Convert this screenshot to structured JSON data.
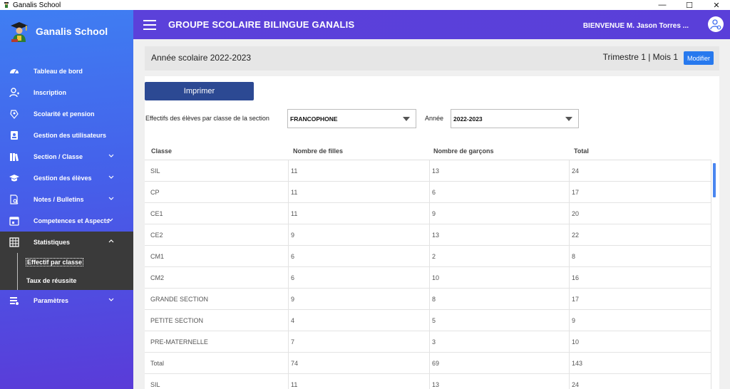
{
  "window": {
    "title": "Ganalis School",
    "controls": {
      "minimize": "—",
      "maximize": "☐",
      "close": "✕"
    }
  },
  "sidebar": {
    "brand": "Ganalis School",
    "items": [
      {
        "label": "Tableau de bord",
        "icon": "gauge-icon"
      },
      {
        "label": "Inscription",
        "icon": "add-user-icon"
      },
      {
        "label": "Scolarité et pension",
        "icon": "money-hand-icon"
      },
      {
        "label": "Gestion des utilisateurs",
        "icon": "id-badge-icon"
      },
      {
        "label": "Section / Classe",
        "icon": "books-icon"
      },
      {
        "label": "Gestion des élèves",
        "icon": "graduation-cap-icon"
      },
      {
        "label": "Notes / Bulletins",
        "icon": "document-search-icon"
      },
      {
        "label": "Competences et Aspects",
        "icon": "calendar-icon"
      },
      {
        "label": "Statistiques",
        "icon": "table-grid-icon"
      },
      {
        "label": "Paramètres",
        "icon": "settings-sliders-icon"
      }
    ],
    "statistics_sub": [
      "Effectif par classe",
      "Taux de réussite"
    ]
  },
  "header": {
    "org_name": "GROUPE SCOLAIRE BILINGUE GANALIS",
    "welcome": "BIENVENUE M.  Jason Torres ..."
  },
  "yearbar": {
    "label": "Année scolaire 2022-2023",
    "period": "Trimestre 1 | Mois  1",
    "modify": "Modifier"
  },
  "panel": {
    "print": "Imprimer",
    "filter_label": "Effectifs des élèves par classe de la section",
    "section_value": "FRANCOPHONE",
    "year_label": "Année",
    "year_value": "2022-2023"
  },
  "table": {
    "headers": [
      "Classe",
      "Nombre de filles",
      "Nombre de garçons",
      "Total"
    ],
    "rows": [
      [
        "SIL",
        "11",
        "13",
        "24"
      ],
      [
        "CP",
        "11",
        "6",
        "17"
      ],
      [
        "CE1",
        "11",
        "9",
        "20"
      ],
      [
        "CE2",
        "9",
        "13",
        "22"
      ],
      [
        "CM1",
        "6",
        "2",
        "8"
      ],
      [
        "CM2",
        "6",
        "10",
        "16"
      ],
      [
        "GRANDE SECTION",
        "9",
        "8",
        "17"
      ],
      [
        "PETITE SECTION",
        "4",
        "5",
        "9"
      ],
      [
        "PRE-MATERNELLE",
        "7",
        "3",
        "10"
      ],
      [
        "Total",
        "74",
        "69",
        "143"
      ],
      [
        "SIL",
        "11",
        "13",
        "24"
      ]
    ]
  },
  "colors": {
    "sidebar_top": "#3f7ef2",
    "sidebar_bottom": "#5a3bd8",
    "header": "#5b41da",
    "print_button": "#2c4993",
    "modify_button": "#2779ee",
    "active_menu": "#3a3a3a"
  }
}
